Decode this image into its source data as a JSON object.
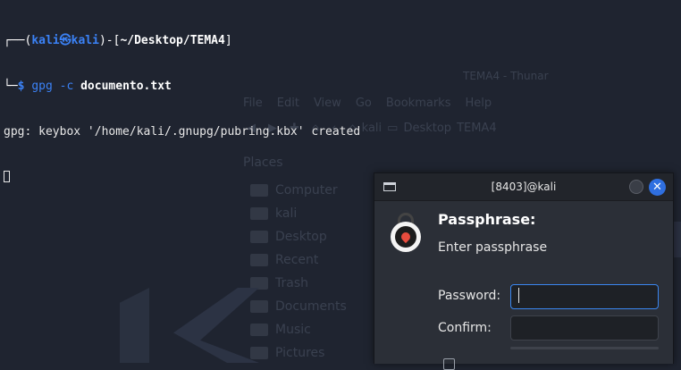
{
  "terminal": {
    "prompt_open": "┌──(",
    "user": "kali",
    "at": "㉿",
    "host": "kali",
    "path_sep": ")-[",
    "path": "~/Desktop/TEMA4",
    "path_close": "]",
    "prompt_end": "└─",
    "dollar": "$ ",
    "cmd": "gpg -c ",
    "arg": "documento.txt",
    "output": "gpg: keybox '/home/kali/.gnupg/pubring.kbx' created"
  },
  "file_manager": {
    "title": "TEMA4 - Thunar",
    "menu": [
      "File",
      "Edit",
      "View",
      "Go",
      "Bookmarks",
      "Help"
    ],
    "crumbs": [
      "kali",
      "Desktop",
      "TEMA4"
    ],
    "places_header": "Places",
    "places": [
      "Computer",
      "kali",
      "Desktop",
      "Recent",
      "Trash",
      "Documents",
      "Music",
      "Pictures"
    ]
  },
  "pinentry": {
    "title": "[8403]@kali",
    "heading": "Passphrase:",
    "description": "Enter passphrase",
    "password_label": "Password:",
    "password_value": "",
    "confirm_label": "Confirm:",
    "confirm_value": "",
    "close_glyph": "✕"
  },
  "colors": {
    "accent": "#2f6fe0",
    "terminal_blue": "#3b82f6",
    "background": "#1f2430"
  }
}
